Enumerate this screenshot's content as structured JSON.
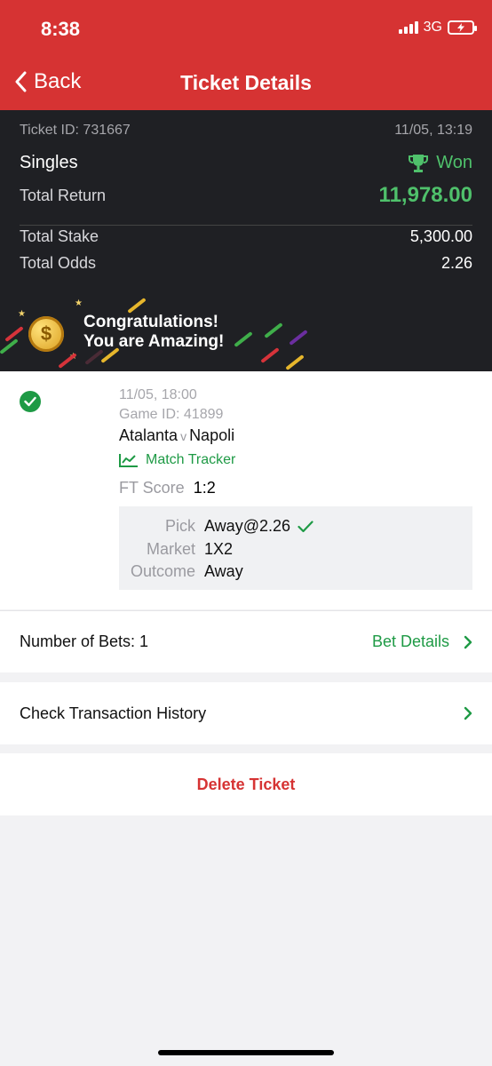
{
  "status_bar": {
    "time": "8:38",
    "network": "3G"
  },
  "nav": {
    "back_label": "Back",
    "title": "Ticket Details"
  },
  "summary": {
    "ticket_id": "Ticket ID: 731667",
    "datetime": "11/05, 13:19",
    "bet_type": "Singles",
    "status": "Won",
    "total_return_label": "Total Return",
    "total_return_value": "11,978.00",
    "total_stake_label": "Total Stake",
    "total_stake_value": "5,300.00",
    "total_odds_label": "Total Odds",
    "total_odds_value": "2.26"
  },
  "congrats": {
    "line1": "Congratulations!",
    "line2": "You are Amazing!",
    "coin_symbol": "$"
  },
  "bet": {
    "datetime": "11/05, 18:00",
    "game_id": "Game ID: 41899",
    "home": "Atalanta",
    "vs": "v",
    "away": "Napoli",
    "tracker_label": "Match Tracker",
    "score_label": "FT Score",
    "score_value": "1:2",
    "pick_label": "Pick",
    "pick_value": "Away@2.26",
    "market_label": "Market",
    "market_value": "1X2",
    "outcome_label": "Outcome",
    "outcome_value": "Away"
  },
  "bets_row": {
    "label": "Number of Bets: 1",
    "action": "Bet Details"
  },
  "history_row": {
    "label": "Check Transaction History"
  },
  "delete": {
    "label": "Delete Ticket"
  },
  "colors": {
    "header_red": "#d63333",
    "summary_dark": "#1f2024",
    "win_green": "#4fc16b",
    "accent_green": "#1e9a45"
  }
}
